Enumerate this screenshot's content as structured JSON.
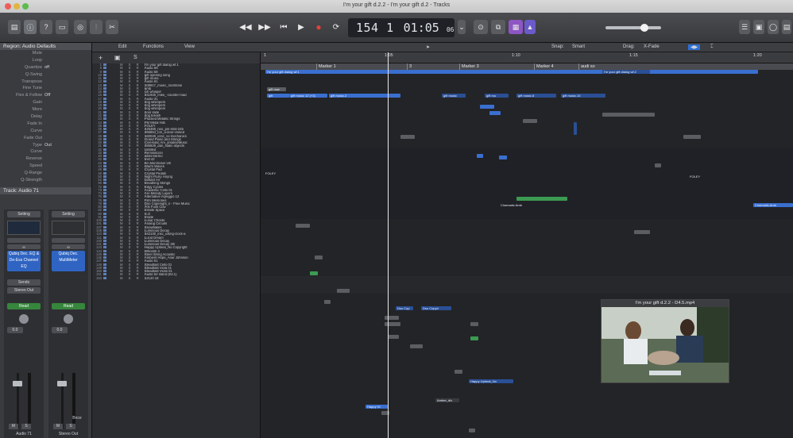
{
  "window": {
    "title": "I'm your gift d.2.2 - I'm your gift d.2 - Tracks"
  },
  "transport": {
    "position": "154 1",
    "time": "01:05",
    "time_frames": "06"
  },
  "inspector": {
    "region_header": "Region: Audio Defaults",
    "params": [
      {
        "k": "Mute",
        "v": ""
      },
      {
        "k": "Loop",
        "v": ""
      },
      {
        "k": "Quantize",
        "v": "off"
      },
      {
        "k": "Q-Swing",
        "v": ""
      },
      {
        "k": "Transpose",
        "v": ""
      },
      {
        "k": "Fine Tune",
        "v": ""
      },
      {
        "k": "Flex & Follow",
        "v": "Off"
      },
      {
        "k": "Gain",
        "v": ""
      },
      {
        "k": "More",
        "v": ""
      },
      {
        "k": "Delay",
        "v": ""
      },
      {
        "k": "Fade In",
        "v": ""
      },
      {
        "k": "Curve",
        "v": ""
      },
      {
        "k": "Fade Out",
        "v": ""
      },
      {
        "k": "Type",
        "v": "Out"
      },
      {
        "k": "Curve",
        "v": ""
      },
      {
        "k": "Reverse",
        "v": ""
      },
      {
        "k": "Speed",
        "v": ""
      },
      {
        "k": "Q-Range",
        "v": ""
      },
      {
        "k": "Q-Strength",
        "v": ""
      }
    ],
    "track_header": "Track: Audio 71",
    "strip1": {
      "setting": "Setting",
      "plugins": [
        "Qubiq Dec. EQ & De-Ess Channel EQ"
      ],
      "send": "Sends",
      "output": "Stereo Out",
      "auto": "Read",
      "value": "0.0",
      "name": "Audio 71"
    },
    "strip2": {
      "setting": "Setting",
      "plugins": [
        "Qubiq Dec. MultiMeter"
      ],
      "output": "",
      "auto": "Read",
      "value": "0.0",
      "name": "Stereo Out"
    },
    "mute": "M",
    "solo": "S",
    "bounce": "Bnce"
  },
  "toolbar": {
    "edit": "Edit",
    "functions": "Functions",
    "view": "View",
    "snap_label": "Snap:",
    "snap_value": "Smart",
    "drag_label": "Drag:",
    "drag_value": "X-Fade"
  },
  "ruler": {
    "bars": [
      "1",
      "1:05",
      "1:10",
      "1:15",
      "1:20"
    ],
    "markers": [
      "Marker 1",
      "3",
      "Marker 3",
      "Marker 4",
      "audi so"
    ]
  },
  "tracks": [
    {
      "n": "1",
      "name": "I'm your gift dialog wf.1"
    },
    {
      "n": "8",
      "name": "Audio 68"
    },
    {
      "n": "9",
      "name": "Audio 58"
    },
    {
      "n": "10",
      "name": "gift opening song"
    },
    {
      "n": "11",
      "name": "gift music"
    },
    {
      "n": "12",
      "name": "Audio 61"
    },
    {
      "n": "13",
      "name": "108917_music_roomtone"
    },
    {
      "n": "14",
      "name": "amb"
    },
    {
      "n": "15",
      "name": "cih whisper"
    },
    {
      "n": "16",
      "name": "341925_mike_-counter-road"
    },
    {
      "n": "17",
      "name": "Audio 31"
    },
    {
      "n": "18",
      "name": "dog whimpers"
    },
    {
      "n": "19",
      "name": "dog whimpers"
    },
    {
      "n": "20",
      "name": "dog whimpers"
    },
    {
      "n": "21",
      "name": "door slide"
    },
    {
      "n": "22",
      "name": "dog breath"
    },
    {
      "n": "23",
      "name": "Plucked Metallic Strings"
    },
    {
      "n": "24",
      "name": "FM Metal Hits"
    },
    {
      "n": "25",
      "name": "FOLEY"
    },
    {
      "n": "26",
      "name": "425369_neo_pin-shot-24b"
    },
    {
      "n": "27",
      "name": "466864_ton_a-door-closed"
    },
    {
      "n": "28",
      "name": "160048_ionic_vv-mechanics"
    },
    {
      "n": "29",
      "name": "Grand Piano and Strings"
    },
    {
      "n": "30",
      "name": "Cinematic Am_amakseMusic"
    },
    {
      "n": "31",
      "name": "385829_dan_static-objects"
    },
    {
      "n": "32",
      "name": "Untitled"
    },
    {
      "n": "33",
      "name": "Reminiscion"
    },
    {
      "n": "40",
      "name": "white-blemo"
    },
    {
      "n": "42",
      "name": "Inst 42"
    },
    {
      "n": "43",
      "name": "BA Morchoser UK"
    },
    {
      "n": "44",
      "name": "Warm Waves"
    },
    {
      "n": "45",
      "name": "Crystal Pad"
    },
    {
      "n": "48",
      "name": "Crystal Pedals"
    },
    {
      "n": "50",
      "name": "Night Flurry Hoyng"
    },
    {
      "n": "52",
      "name": "Distant Air"
    },
    {
      "n": "59",
      "name": "Breathing Strings"
    },
    {
      "n": "72",
      "name": "Edgy Cycles"
    },
    {
      "n": "73",
      "name": "Academic Cello 01"
    },
    {
      "n": "74",
      "name": "Are Melody Layers"
    },
    {
      "n": "75",
      "name": "Alternative Arpeggio 12"
    },
    {
      "n": "76",
      "name": "Film Memories"
    },
    {
      "n": "78",
      "name": "Dso Copenight_n - Free Music"
    },
    {
      "n": "80",
      "name": "70s Funk Clav"
    },
    {
      "n": "82",
      "name": "Infinite Space"
    },
    {
      "n": "90",
      "name": "S.O"
    },
    {
      "n": "91",
      "name": "Inside"
    },
    {
      "n": "100",
      "name": "Lunar Chords"
    },
    {
      "n": "101",
      "name": "Analog Circuits"
    },
    {
      "n": "107",
      "name": "Snowflakes"
    },
    {
      "n": "108",
      "name": "Luminous Decay"
    },
    {
      "n": "110",
      "name": "343130_insc_icking-clock-a"
    },
    {
      "n": "111",
      "name": "Lucid Dream"
    },
    {
      "n": "140",
      "name": "Luminous Decay"
    },
    {
      "n": "141",
      "name": "Luminous Decay 3th"
    },
    {
      "n": "143",
      "name": "Happy Upbeat_No Copyright"
    },
    {
      "n": "144",
      "name": "Whoosh 4"
    },
    {
      "n": "145",
      "name": "Steel String Acoustic"
    },
    {
      "n": "146",
      "name": "Ambient Hope_Anar Johnson"
    },
    {
      "n": "147",
      "name": "Audio 51"
    },
    {
      "n": "148",
      "name": "Steadfast Cello 01"
    },
    {
      "n": "149",
      "name": "Steadfast Viola 01"
    },
    {
      "n": "150",
      "name": "Steadfast Violin 01"
    },
    {
      "n": "151",
      "name": "Audio 54 stand (Ed.1)"
    },
    {
      "n": "153",
      "name": "12120 18"
    }
  ],
  "regions": {
    "dialog": "I'm your gift dialog wf.1",
    "dialog2": "I'm your gift dialog wf.2",
    "gift_now": "gift now",
    "gift": "gift",
    "gift_music": "gift music 12 (+3)",
    "gift_music2": "gift music.2",
    "gift_music3": "gift music",
    "gift_music4": "gift mu",
    "gift_music5": "gift music.8",
    "gift_music6": "gift music.10",
    "foley": "FOLEY",
    "foley2": "FOLEY",
    "cinematic": "Cinematic Amb",
    "cinematic2": "Cinematic Amb",
    "dso": "Dso Cop",
    "dso2": "Dso Copyri",
    "happy": "Happy Upbeat_No",
    "happy2": "Happy Hi",
    "amb": "Amber_dix"
  },
  "video": {
    "title": "I'm your gift d.2.2 - D4.5.mp4"
  }
}
